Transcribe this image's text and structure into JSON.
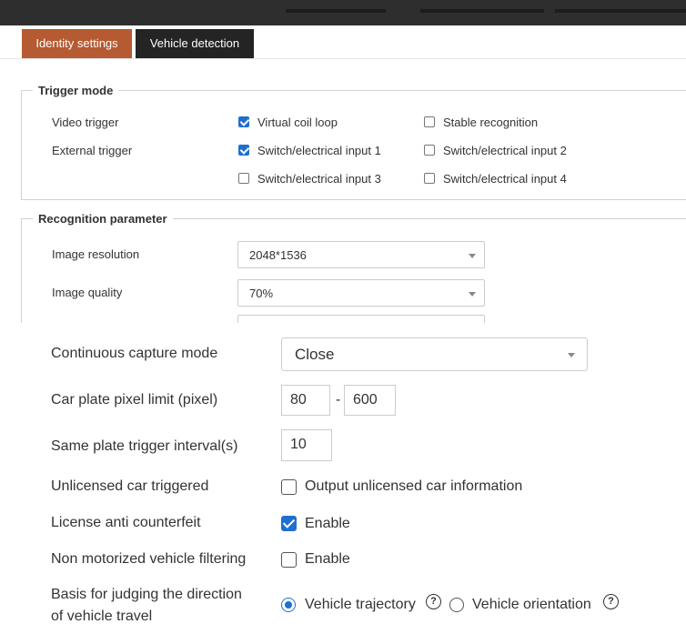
{
  "tabs": [
    {
      "label": "Identity settings",
      "active": true
    },
    {
      "label": "Vehicle detection",
      "active": false
    }
  ],
  "trigger_mode": {
    "legend": "Trigger mode",
    "video_trigger_label": "Video trigger",
    "external_trigger_label": "External trigger",
    "options": [
      {
        "label": "Virtual coil loop",
        "checked": true
      },
      {
        "label": "Stable recognition",
        "checked": false
      },
      {
        "label": "Switch/electrical input 1",
        "checked": true
      },
      {
        "label": "Switch/electrical input 2",
        "checked": false
      },
      {
        "label": "Switch/electrical input 3",
        "checked": false
      },
      {
        "label": "Switch/electrical input 4",
        "checked": false
      }
    ]
  },
  "recognition": {
    "legend": "Recognition parameter",
    "image_resolution_label": "Image resolution",
    "image_resolution_value": "2048*1536",
    "image_quality_label": "Image quality",
    "image_quality_value": "70%"
  },
  "settings": {
    "continuous_capture_label": "Continuous capture mode",
    "continuous_capture_value": "Close",
    "pixel_limit_label": "Car plate pixel limit (pixel)",
    "pixel_min": "80",
    "pixel_sep": "-",
    "pixel_max": "600",
    "same_plate_label": "Same plate trigger interval(s)",
    "same_plate_value": "10",
    "unlicensed_label": "Unlicensed car triggered",
    "unlicensed_option": "Output unlicensed car information",
    "unlicensed_checked": false,
    "anti_counterfeit_label": "License anti counterfeit",
    "anti_counterfeit_option": "Enable",
    "anti_counterfeit_checked": true,
    "non_motor_label": "Non motorized vehicle filtering",
    "non_motor_option": "Enable",
    "non_motor_checked": false,
    "direction_label_line1": "Basis for judging the direction",
    "direction_label_line2": "of vehicle travel",
    "direction_options": [
      {
        "label": "Vehicle trajectory",
        "selected": true
      },
      {
        "label": "Vehicle orientation",
        "selected": false
      }
    ],
    "help_icon": "?"
  },
  "colors": {
    "active_tab": "#b55a32",
    "inactive_tab": "#242424",
    "accent": "#1f6fd0"
  }
}
